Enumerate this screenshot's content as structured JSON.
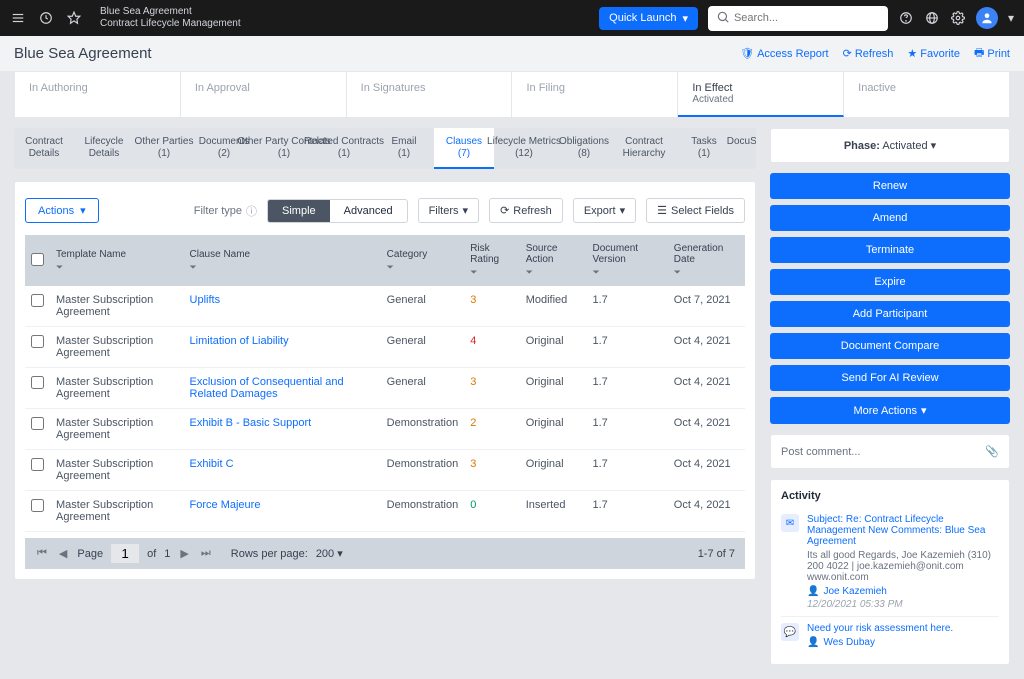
{
  "topbar": {
    "breadcrumb_top": "Blue Sea Agreement",
    "breadcrumb_bottom": "Contract Lifecycle Management",
    "quick_launch": "Quick Launch",
    "search_placeholder": "Search..."
  },
  "header": {
    "title": "Blue Sea Agreement",
    "access_report": "Access Report",
    "refresh": "Refresh",
    "favorite": "Favorite",
    "print": "Print"
  },
  "phases": [
    {
      "label": "In Authoring",
      "sub": ""
    },
    {
      "label": "In Approval",
      "sub": ""
    },
    {
      "label": "In Signatures",
      "sub": ""
    },
    {
      "label": "In Filing",
      "sub": ""
    },
    {
      "label": "In Effect",
      "sub": "Activated"
    },
    {
      "label": "Inactive",
      "sub": ""
    }
  ],
  "subtabs": [
    {
      "label": "Contract",
      "sub": "Details"
    },
    {
      "label": "Lifecycle",
      "sub": "Details"
    },
    {
      "label": "Other Parties",
      "sub": "(1)"
    },
    {
      "label": "Documents",
      "sub": "(2)"
    },
    {
      "label": "Other Party Contacts",
      "sub": "(1)"
    },
    {
      "label": "Related Contracts",
      "sub": "(1)"
    },
    {
      "label": "Email",
      "sub": "(1)"
    },
    {
      "label": "Clauses",
      "sub": "(7)"
    },
    {
      "label": "Lifecycle Metrics",
      "sub": "(12)"
    },
    {
      "label": "Obligations",
      "sub": "(8)"
    },
    {
      "label": "Contract",
      "sub": "Hierarchy"
    },
    {
      "label": "Tasks",
      "sub": "(1)"
    },
    {
      "label": "DocuSign Status",
      "sub": ""
    }
  ],
  "toolbar": {
    "actions": "Actions",
    "filter_type": "Filter type",
    "simple": "Simple",
    "advanced": "Advanced",
    "filters": "Filters",
    "refresh": "Refresh",
    "export": "Export",
    "select_fields": "Select Fields"
  },
  "columns": [
    "",
    "Template Name",
    "Clause Name",
    "Category",
    "Risk Rating",
    "Source Action",
    "Document Version",
    "Generation Date"
  ],
  "rows": [
    {
      "template": "Master Subscription Agreement",
      "clause": "Uplifts",
      "category": "General",
      "rating": "3",
      "rclass": "rating-3",
      "source": "Modified",
      "version": "1.7",
      "date": "Oct 7, 2021"
    },
    {
      "template": "Master Subscription Agreement",
      "clause": "Limitation of Liability",
      "category": "General",
      "rating": "4",
      "rclass": "rating-4",
      "source": "Original",
      "version": "1.7",
      "date": "Oct 4, 2021"
    },
    {
      "template": "Master Subscription Agreement",
      "clause": "Exclusion of Consequential and Related Damages",
      "category": "General",
      "rating": "3",
      "rclass": "rating-3",
      "source": "Original",
      "version": "1.7",
      "date": "Oct 4, 2021"
    },
    {
      "template": "Master Subscription Agreement",
      "clause": "Exhibit B - Basic Support",
      "category": "Demonstration",
      "rating": "2",
      "rclass": "rating-2",
      "source": "Original",
      "version": "1.7",
      "date": "Oct 4, 2021"
    },
    {
      "template": "Master Subscription Agreement",
      "clause": "Exhibit C",
      "category": "Demonstration",
      "rating": "3",
      "rclass": "rating-3",
      "source": "Original",
      "version": "1.7",
      "date": "Oct 4, 2021"
    },
    {
      "template": "Master Subscription Agreement",
      "clause": "Force Majeure",
      "category": "Demonstration",
      "rating": "0",
      "rclass": "rating-0",
      "source": "Inserted",
      "version": "1.7",
      "date": "Oct 4, 2021"
    }
  ],
  "pager": {
    "page_label": "Page",
    "page": "1",
    "of": "of",
    "total": "1",
    "rows_label": "Rows per page:",
    "rows": "200",
    "summary": "1-7 of 7"
  },
  "side": {
    "phase_label": "Phase:",
    "phase_value": "Activated",
    "actions": [
      "Renew",
      "Amend",
      "Terminate",
      "Expire",
      "Add Participant",
      "Document Compare",
      "Send For AI Review",
      "More Actions"
    ],
    "comment_placeholder": "Post comment...",
    "activity_title": "Activity",
    "activity": [
      {
        "icon": "✉",
        "subject": "Subject: Re: Contract Lifecycle Management New Comments: Blue Sea Agreement",
        "body": "Its all good Regards, Joe Kazemieh (310) 200 4022 | joe.kazemieh@onit.com www.onit.com",
        "user": "Joe Kazemieh",
        "ts": "12/20/2021 05:33 PM"
      },
      {
        "icon": "💬",
        "subject": "Need your risk assessment here.",
        "body": "",
        "user": "Wes Dubay",
        "ts": ""
      }
    ]
  }
}
